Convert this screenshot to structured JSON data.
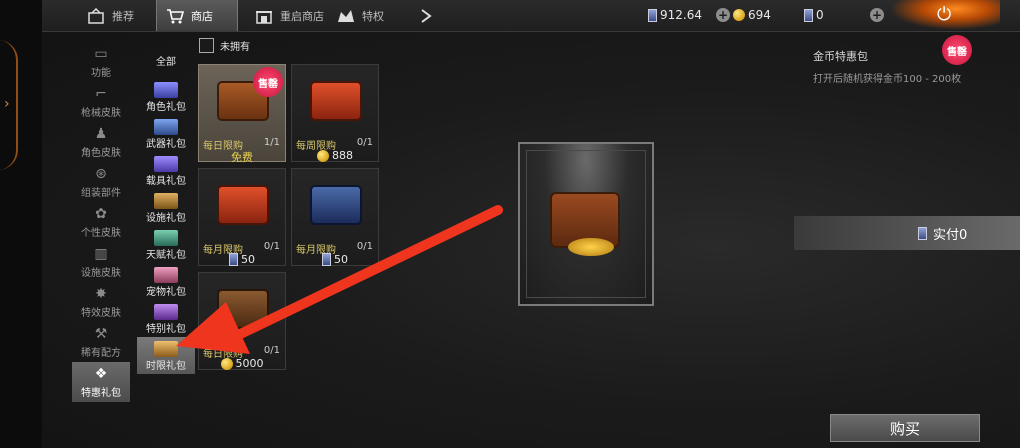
{
  "nav": {
    "tabs": [
      {
        "label": "推荐",
        "icon": "recommend-icon"
      },
      {
        "label": "商店",
        "icon": "shopping-cart-icon"
      },
      {
        "label": "重启商店",
        "icon": "restart-shop-icon"
      },
      {
        "label": "特权",
        "icon": "privilege-icon"
      }
    ],
    "more_icon": "chevron-right-icon"
  },
  "resources": {
    "card_balance": "912.64",
    "gold": "694",
    "tickets": "0"
  },
  "categories": [
    {
      "label": "功能",
      "icon": "function-icon"
    },
    {
      "label": "枪械皮肤",
      "icon": "gun-icon"
    },
    {
      "label": "角色皮肤",
      "icon": "character-icon"
    },
    {
      "label": "组装部件",
      "icon": "steering-wheel-icon"
    },
    {
      "label": "个性皮肤",
      "icon": "style-icon"
    },
    {
      "label": "设施皮肤",
      "icon": "facility-icon"
    },
    {
      "label": "特效皮肤",
      "icon": "effect-icon"
    },
    {
      "label": "稀有配方",
      "icon": "recipe-icon"
    },
    {
      "label": "特惠礼包",
      "icon": "gift-icon"
    }
  ],
  "subcategories": {
    "all": "全部",
    "items": [
      {
        "label": "角色礼包",
        "color": "#5a5fd0"
      },
      {
        "label": "武器礼包",
        "color": "#4a6fc0"
      },
      {
        "label": "载具礼包",
        "color": "#6a5ad8"
      },
      {
        "label": "设施礼包",
        "color": "#b78a3a"
      },
      {
        "label": "天赋礼包",
        "color": "#3a8a7a"
      },
      {
        "label": "宠物礼包",
        "color": "#c06a8a"
      },
      {
        "label": "特别礼包",
        "color": "#8a4ac0"
      },
      {
        "label": "时限礼包",
        "color": "#c08a3a"
      }
    ]
  },
  "filter": {
    "not_owned_label": "未拥有"
  },
  "items": [
    {
      "limit": "每日限购",
      "count": "1/1",
      "price": "免费",
      "sale": "售罄",
      "currency": ""
    },
    {
      "limit": "每周限购",
      "count": "0/1",
      "price": "888",
      "currency": "coin"
    },
    {
      "limit": "每月限购",
      "count": "0/1",
      "price": "50",
      "currency": "card"
    },
    {
      "limit": "每月限购",
      "count": "0/1",
      "price": "50",
      "currency": "card"
    },
    {
      "limit": "每日限购",
      "count": "0/1",
      "price": "5000",
      "currency": "coin"
    }
  ],
  "detail": {
    "title": "金币特惠包",
    "description": "打开后随机获得金币100 - 200枚",
    "badge": "售罄",
    "pay_label": "实付0",
    "buy_label": "购买"
  }
}
